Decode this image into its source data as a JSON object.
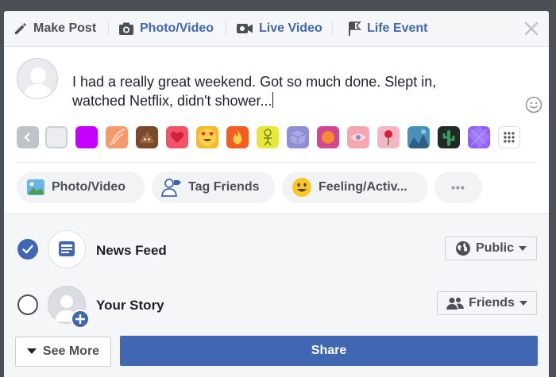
{
  "tabs": [
    {
      "label": "Make Post",
      "icon": "pencil-icon"
    },
    {
      "label": "Photo/Video",
      "icon": "camera-icon"
    },
    {
      "label": "Live Video",
      "icon": "video-camera-icon"
    },
    {
      "label": "Life Event",
      "icon": "flag-icon"
    }
  ],
  "composer": {
    "text_line1": "I had a really great weekend. Got so much done. Slept in,",
    "text_line2": "watched Netflix, didn't shower..."
  },
  "backgrounds": [
    {
      "name": "back-arrow",
      "color": "#bec3c9"
    },
    {
      "name": "white",
      "color": "#ebedf0"
    },
    {
      "name": "purple",
      "color": "#c600ff"
    },
    {
      "name": "coral-leaves",
      "color": "#f79a6b"
    },
    {
      "name": "poop",
      "color": "#7b4a2b"
    },
    {
      "name": "heart",
      "color": "#f25268"
    },
    {
      "name": "heart-eyes",
      "color": "#f7b928"
    },
    {
      "name": "fire",
      "color": "#f45d22"
    },
    {
      "name": "yellow-figure",
      "color": "#e8e73a"
    },
    {
      "name": "lavender-cube",
      "color": "#8f8fd8"
    },
    {
      "name": "orange-circle",
      "color": "#d54690"
    },
    {
      "name": "pink-eye",
      "color": "#f4a7b0"
    },
    {
      "name": "rose",
      "color": "#f5b6c3"
    },
    {
      "name": "blue-scene",
      "color": "#4a90b8"
    },
    {
      "name": "cactus",
      "color": "#1f2a24"
    },
    {
      "name": "purple-geo",
      "color": "#9360f7"
    },
    {
      "name": "more-grid",
      "color": "#ffffff"
    }
  ],
  "actions": [
    {
      "label": "Photo/Video",
      "icon": "photo-icon"
    },
    {
      "label": "Tag Friends",
      "icon": "tag-friends-icon"
    },
    {
      "label": "Feeling/Activ...",
      "icon": "smiley-icon"
    },
    {
      "label": "•••",
      "icon": "more-icon"
    }
  ],
  "destinations": [
    {
      "label": "News Feed",
      "checked": true,
      "audience": "Public",
      "audience_icon": "globe-icon"
    },
    {
      "label": "Your Story",
      "checked": false,
      "audience": "Friends",
      "audience_icon": "friends-icon"
    }
  ],
  "footer": {
    "see_more": "See More",
    "share": "Share"
  },
  "colors": {
    "brand": "#4267b2",
    "text": "#1d2129",
    "muted": "#4b4f56"
  }
}
